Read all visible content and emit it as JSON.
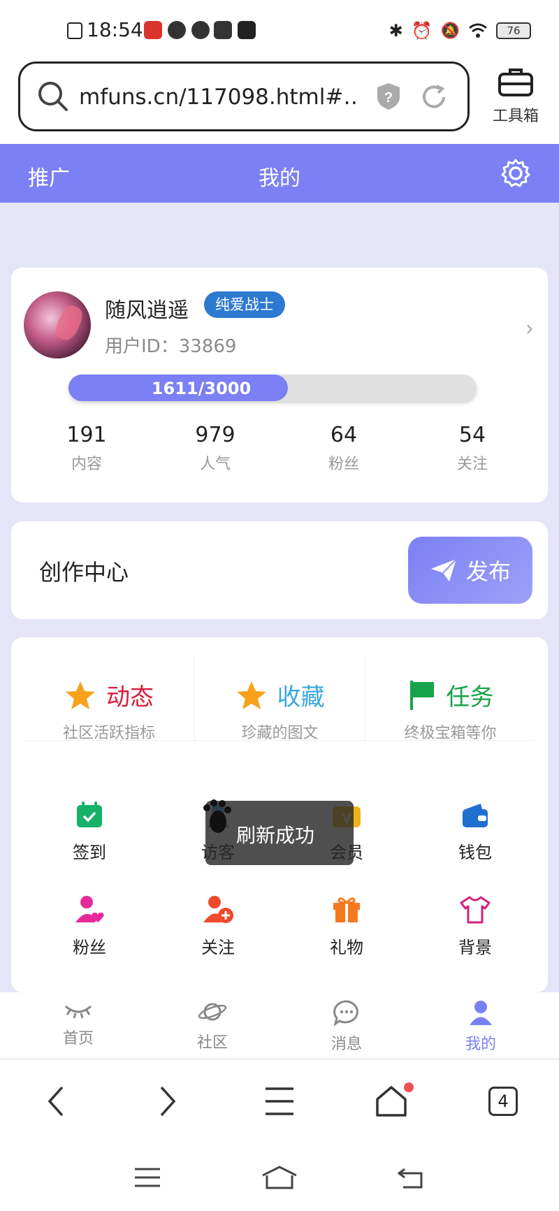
{
  "status_bar": {
    "time": "18:54",
    "battery": "76"
  },
  "browser": {
    "url": "mfuns.cn/117098.html#…",
    "toolbox_label": "工具箱",
    "tab_count": "4"
  },
  "header": {
    "promo": "推广",
    "title": "我的"
  },
  "profile": {
    "username": "随风逍遥",
    "badge": "纯爱战士",
    "user_id": "用户ID：33869",
    "progress_text": "1611/3000",
    "progress_fraction": 0.537,
    "stats": [
      {
        "value": "191",
        "label": "内容"
      },
      {
        "value": "979",
        "label": "人气"
      },
      {
        "value": "64",
        "label": "粉丝"
      },
      {
        "value": "54",
        "label": "关注"
      }
    ]
  },
  "create": {
    "title": "创作中心",
    "publish": "发布"
  },
  "features": [
    {
      "title": "动态",
      "sub": "社区活跃指标",
      "color": "#d81e3c"
    },
    {
      "title": "收藏",
      "sub": "珍藏的图文",
      "color": "#3aa7e0"
    },
    {
      "title": "任务",
      "sub": "终极宝箱等你",
      "color": "#17a34a"
    }
  ],
  "grid": [
    {
      "label": "签到"
    },
    {
      "label": "访客"
    },
    {
      "label": "会员"
    },
    {
      "label": "钱包"
    },
    {
      "label": "粉丝"
    },
    {
      "label": "关注"
    },
    {
      "label": "礼物"
    },
    {
      "label": "背景"
    }
  ],
  "toast": "刷新成功",
  "tabs": [
    {
      "label": "首页"
    },
    {
      "label": "社区"
    },
    {
      "label": "消息"
    },
    {
      "label": "我的"
    }
  ],
  "colors": {
    "accent": "#7b80f4",
    "background": "#e4e6f8",
    "badge": "#2e79d0"
  }
}
